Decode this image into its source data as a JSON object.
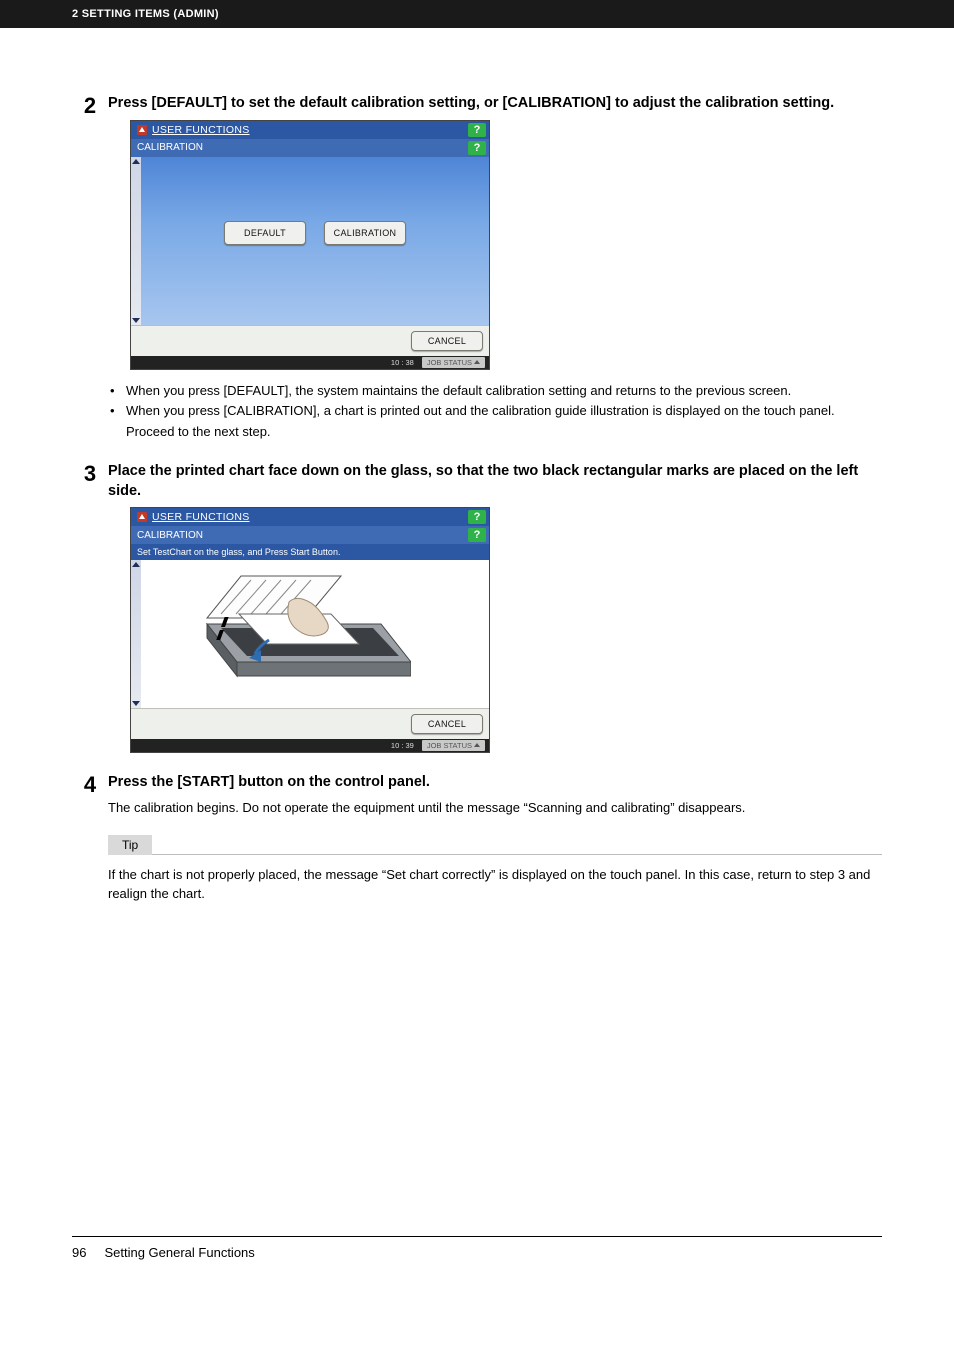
{
  "header": {
    "section_label": "2 SETTING ITEMS (ADMIN)"
  },
  "steps": {
    "s2": {
      "num": "2",
      "title": "Press [DEFAULT] to set the default calibration setting, or [CALIBRATION] to adjust the calibration setting.",
      "screenshot": {
        "header_title": "USER FUNCTIONS",
        "sub_title": "CALIBRATION",
        "help": "?",
        "buttons": {
          "default": "DEFAULT",
          "calibration": "CALIBRATION",
          "cancel": "CANCEL"
        },
        "footer_time": "10 : 38",
        "footer_job": "JOB STATUS"
      },
      "bullets": [
        "When you press [DEFAULT], the system maintains the default calibration setting and returns to the previous screen.",
        "When you press [CALIBRATION], a chart is printed out and the calibration guide illustration is displayed on the touch panel."
      ],
      "bullet2_extra": "Proceed to the next step."
    },
    "s3": {
      "num": "3",
      "title": "Place the printed chart face down on the glass, so that the two black rectangular marks are placed on the left side.",
      "screenshot": {
        "header_title": "USER FUNCTIONS",
        "sub_title": "CALIBRATION",
        "instruction": "Set TestChart on the glass, and Press Start Button.",
        "help": "?",
        "cancel": "CANCEL",
        "footer_time": "10 : 39",
        "footer_job": "JOB STATUS"
      }
    },
    "s4": {
      "num": "4",
      "title": "Press the [START] button on the control panel.",
      "desc": "The calibration begins. Do not operate the equipment until the message “Scanning and calibrating” disappears.",
      "tip_label": "Tip",
      "tip_text": "If the chart is not properly placed, the message “Set chart correctly” is displayed on the touch panel. In this case, return to step 3 and realign the chart."
    }
  },
  "footer": {
    "page_number": "96",
    "section": "Setting General Functions"
  }
}
